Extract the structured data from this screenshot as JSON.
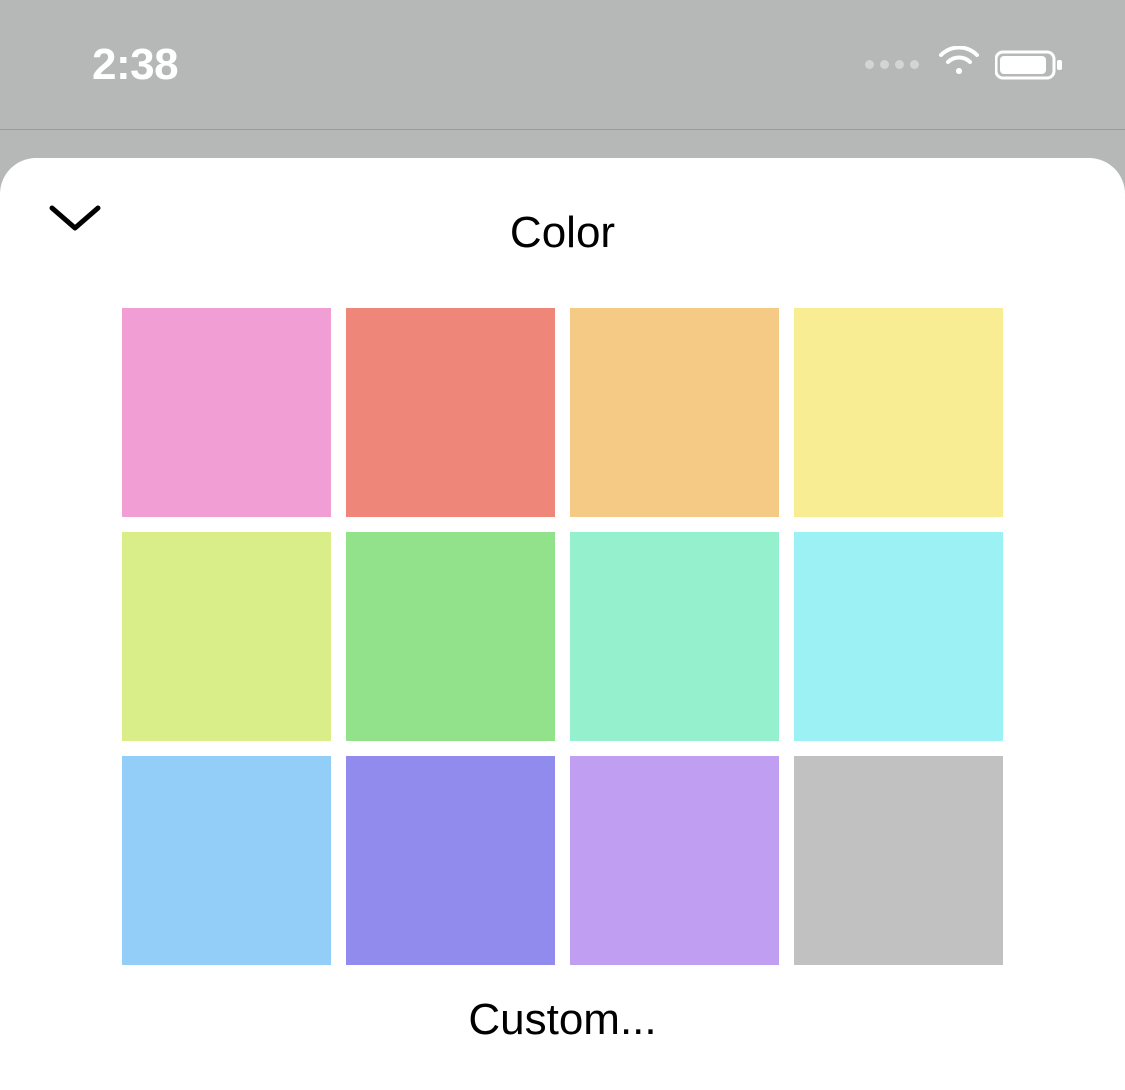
{
  "status": {
    "time": "2:38"
  },
  "sheet": {
    "title": "Color",
    "custom_label": "Custom...",
    "swatches": [
      {
        "name": "pink",
        "hex": "#f19ed4"
      },
      {
        "name": "coral",
        "hex": "#ee8779"
      },
      {
        "name": "orange",
        "hex": "#f4ca84"
      },
      {
        "name": "yellow",
        "hex": "#f9ed94"
      },
      {
        "name": "lime",
        "hex": "#d9ed89"
      },
      {
        "name": "green",
        "hex": "#92e18b"
      },
      {
        "name": "mint",
        "hex": "#95f0cd"
      },
      {
        "name": "cyan",
        "hex": "#9bf1f3"
      },
      {
        "name": "skyblue",
        "hex": "#93cef8"
      },
      {
        "name": "periwinkle",
        "hex": "#918bee"
      },
      {
        "name": "lavender",
        "hex": "#c09ef2"
      },
      {
        "name": "gray",
        "hex": "#c1c1c1"
      }
    ]
  }
}
